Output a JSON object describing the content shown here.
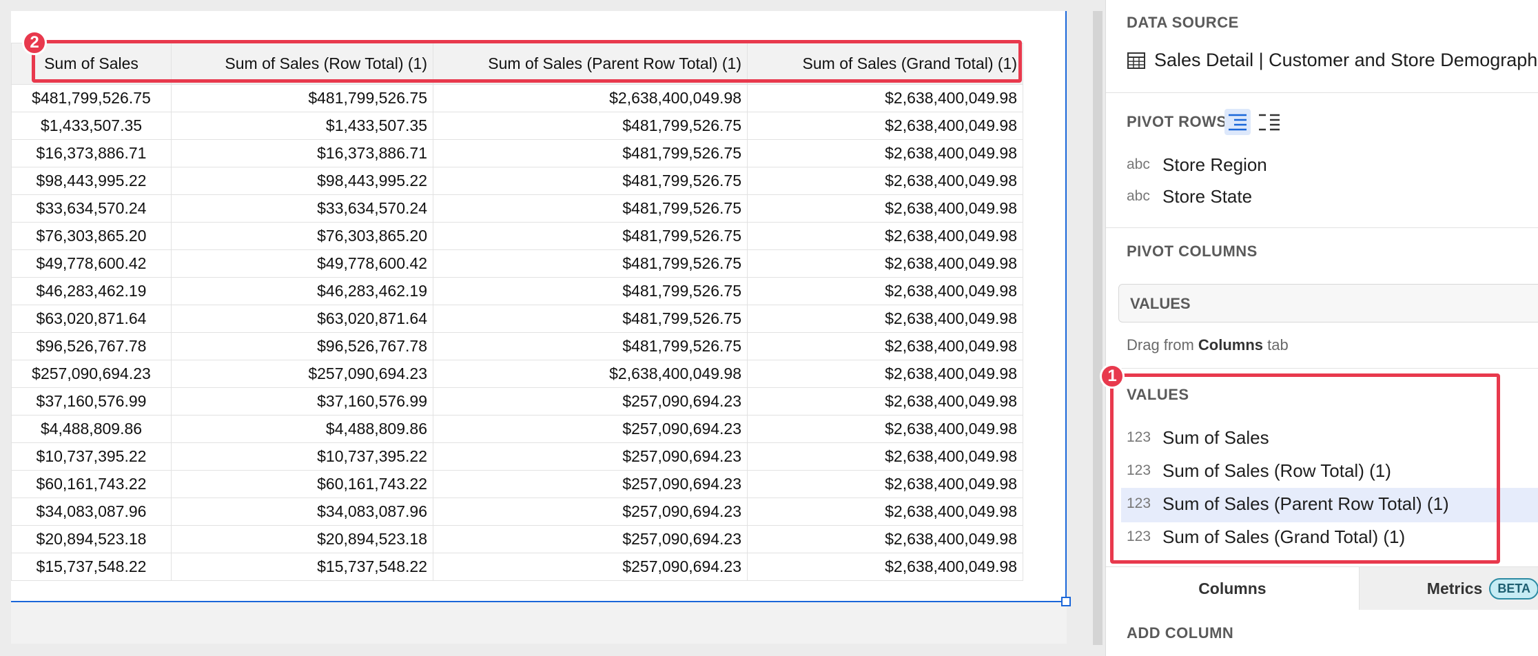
{
  "table": {
    "headers": [
      "Sum of Sales",
      "Sum of Sales (Row Total) (1)",
      "Sum of Sales (Parent Row Total) (1)",
      "Sum of Sales (Grand Total) (1)"
    ],
    "rows": [
      [
        "$481,799,526.75",
        "$481,799,526.75",
        "$2,638,400,049.98",
        "$2,638,400,049.98"
      ],
      [
        "$1,433,507.35",
        "$1,433,507.35",
        "$481,799,526.75",
        "$2,638,400,049.98"
      ],
      [
        "$16,373,886.71",
        "$16,373,886.71",
        "$481,799,526.75",
        "$2,638,400,049.98"
      ],
      [
        "$98,443,995.22",
        "$98,443,995.22",
        "$481,799,526.75",
        "$2,638,400,049.98"
      ],
      [
        "$33,634,570.24",
        "$33,634,570.24",
        "$481,799,526.75",
        "$2,638,400,049.98"
      ],
      [
        "$76,303,865.20",
        "$76,303,865.20",
        "$481,799,526.75",
        "$2,638,400,049.98"
      ],
      [
        "$49,778,600.42",
        "$49,778,600.42",
        "$481,799,526.75",
        "$2,638,400,049.98"
      ],
      [
        "$46,283,462.19",
        "$46,283,462.19",
        "$481,799,526.75",
        "$2,638,400,049.98"
      ],
      [
        "$63,020,871.64",
        "$63,020,871.64",
        "$481,799,526.75",
        "$2,638,400,049.98"
      ],
      [
        "$96,526,767.78",
        "$96,526,767.78",
        "$481,799,526.75",
        "$2,638,400,049.98"
      ],
      [
        "$257,090,694.23",
        "$257,090,694.23",
        "$2,638,400,049.98",
        "$2,638,400,049.98"
      ],
      [
        "$37,160,576.99",
        "$37,160,576.99",
        "$257,090,694.23",
        "$2,638,400,049.98"
      ],
      [
        "$4,488,809.86",
        "$4,488,809.86",
        "$257,090,694.23",
        "$2,638,400,049.98"
      ],
      [
        "$10,737,395.22",
        "$10,737,395.22",
        "$257,090,694.23",
        "$2,638,400,049.98"
      ],
      [
        "$60,161,743.22",
        "$60,161,743.22",
        "$257,090,694.23",
        "$2,638,400,049.98"
      ],
      [
        "$34,083,087.96",
        "$34,083,087.96",
        "$257,090,694.23",
        "$2,638,400,049.98"
      ],
      [
        "$20,894,523.18",
        "$20,894,523.18",
        "$257,090,694.23",
        "$2,638,400,049.98"
      ],
      [
        "$15,737,548.22",
        "$15,737,548.22",
        "$257,090,694.23",
        "$2,638,400,049.98"
      ]
    ]
  },
  "annotations": {
    "badge_1": "1",
    "badge_2": "2",
    "highlight_color": "#e8394d"
  },
  "panel": {
    "data_source_title": "DATA SOURCE",
    "data_source_name": "Sales Detail | Customer and Store Demographics",
    "pivot_rows_title": "PIVOT ROWS",
    "pivot_rows": [
      {
        "type": "abc",
        "label": "Store Region"
      },
      {
        "type": "abc",
        "label": "Store State"
      }
    ],
    "pivot_columns_title": "PIVOT COLUMNS",
    "values_box_label": "VALUES",
    "drag_hint_prefix": "Drag from ",
    "drag_hint_bold": "Columns",
    "drag_hint_suffix": " tab",
    "values_title": "VALUES",
    "values": [
      {
        "type": "123",
        "label": "Sum of Sales"
      },
      {
        "type": "123",
        "label": "Sum of Sales (Row Total) (1)"
      },
      {
        "type": "123",
        "label": "Sum of Sales (Parent Row Total) (1)"
      },
      {
        "type": "123",
        "label": "Sum of Sales (Grand Total) (1)"
      }
    ],
    "tabs": {
      "columns": "Columns",
      "metrics": "Metrics",
      "beta": "BETA"
    },
    "add_column": "ADD COLUMN"
  },
  "colors": {
    "accent": "#1a66d9",
    "selected_row": "#e6ecfb"
  }
}
